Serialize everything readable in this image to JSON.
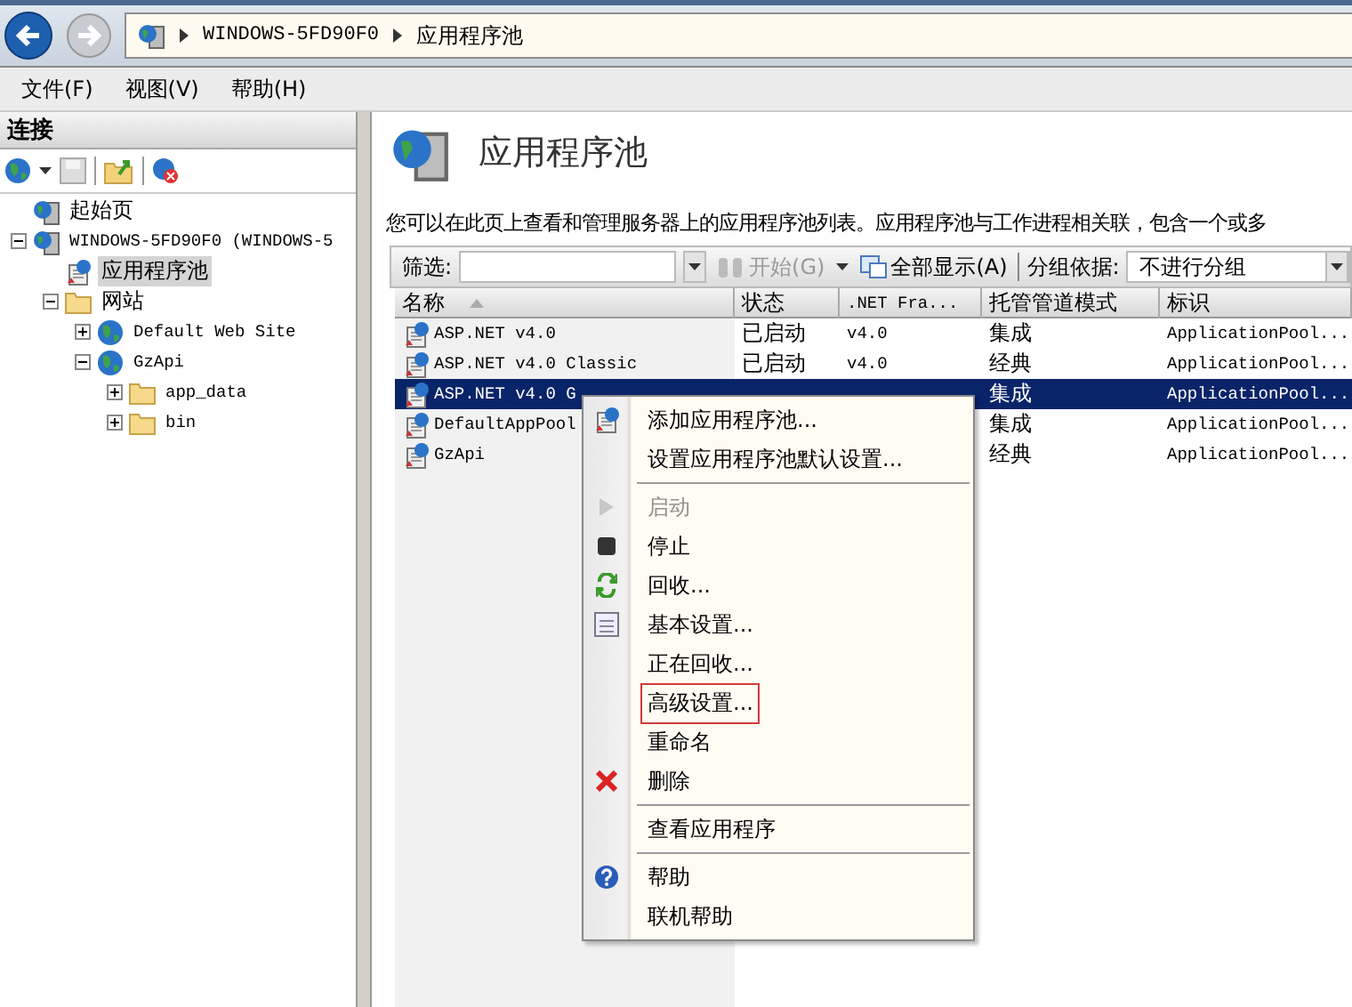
{
  "address_bar": {
    "crumbs": [
      "WINDOWS-5FD90F0",
      "应用程序池"
    ]
  },
  "menu_bar": [
    "文件(F)",
    "视图(V)",
    "帮助(H)"
  ],
  "connections": {
    "title": "连接",
    "tree": [
      {
        "label": "起始页",
        "selected": false
      },
      {
        "label": "WINDOWS-5FD90F0 (WINDOWS-5",
        "selected": false,
        "expanded": true,
        "children": [
          {
            "label": "应用程序池",
            "selected": true
          },
          {
            "label": "网站",
            "selected": false,
            "expanded": true,
            "children": [
              {
                "label": "Default Web Site",
                "selected": false,
                "expanded": false
              },
              {
                "label": "GzApi",
                "selected": false,
                "expanded": true,
                "children": [
                  {
                    "label": "app_data",
                    "selected": false,
                    "expanded": false
                  },
                  {
                    "label": "bin",
                    "selected": false,
                    "expanded": false
                  }
                ]
              }
            ]
          }
        ]
      }
    ]
  },
  "page": {
    "title": "应用程序池",
    "description": "您可以在此页上查看和管理服务器上的应用程序池列表。应用程序池与工作进程相关联，包含一个或多",
    "filter": {
      "label": "筛选:",
      "go": "开始(G)",
      "show_all": "全部显示(A)",
      "group_label": "分组依据:",
      "group_value": "不进行分组"
    },
    "table": {
      "columns": [
        "名称",
        "状态",
        ".NET Fra...",
        "托管管道模式",
        "标识"
      ],
      "rows": [
        {
          "name": "ASP.NET v4.0",
          "status": "已启动",
          "framework": "v4.0",
          "pipeline": "集成",
          "identity": "ApplicationPool...",
          "selected": false
        },
        {
          "name": "ASP.NET v4.0 Classic",
          "status": "已启动",
          "framework": "v4.0",
          "pipeline": "经典",
          "identity": "ApplicationPool...",
          "selected": false
        },
        {
          "name": "ASP.NET v4.0 G",
          "pipeline": "集成",
          "identity": "ApplicationPool...",
          "selected": true
        },
        {
          "name": "DefaultAppPool",
          "pipeline": "集成",
          "identity": "ApplicationPool...",
          "selected": false
        },
        {
          "name": "GzApi",
          "pipeline": "经典",
          "identity": "ApplicationPool...",
          "selected": false
        }
      ]
    }
  },
  "context_menu": {
    "groups": [
      [
        {
          "label": "添加应用程序池...",
          "disabled": false,
          "highlighted": false
        },
        {
          "label": "设置应用程序池默认设置...",
          "disabled": false,
          "highlighted": false
        }
      ],
      [
        {
          "label": "启动",
          "disabled": true,
          "highlighted": false
        },
        {
          "label": "停止",
          "disabled": false,
          "highlighted": false
        },
        {
          "label": "回收...",
          "disabled": false,
          "highlighted": false
        },
        {
          "label": "基本设置...",
          "disabled": false,
          "highlighted": false
        },
        {
          "label": "正在回收...",
          "disabled": false,
          "highlighted": false
        },
        {
          "label": "高级设置...",
          "disabled": false,
          "highlighted": true
        },
        {
          "label": "重命名",
          "disabled": false,
          "highlighted": false
        },
        {
          "label": "删除",
          "disabled": false,
          "highlighted": false
        }
      ],
      [
        {
          "label": "查看应用程序",
          "disabled": false,
          "highlighted": false
        }
      ],
      [
        {
          "label": "帮助",
          "disabled": false,
          "highlighted": false
        },
        {
          "label": "联机帮助",
          "disabled": false,
          "highlighted": false
        }
      ]
    ]
  }
}
